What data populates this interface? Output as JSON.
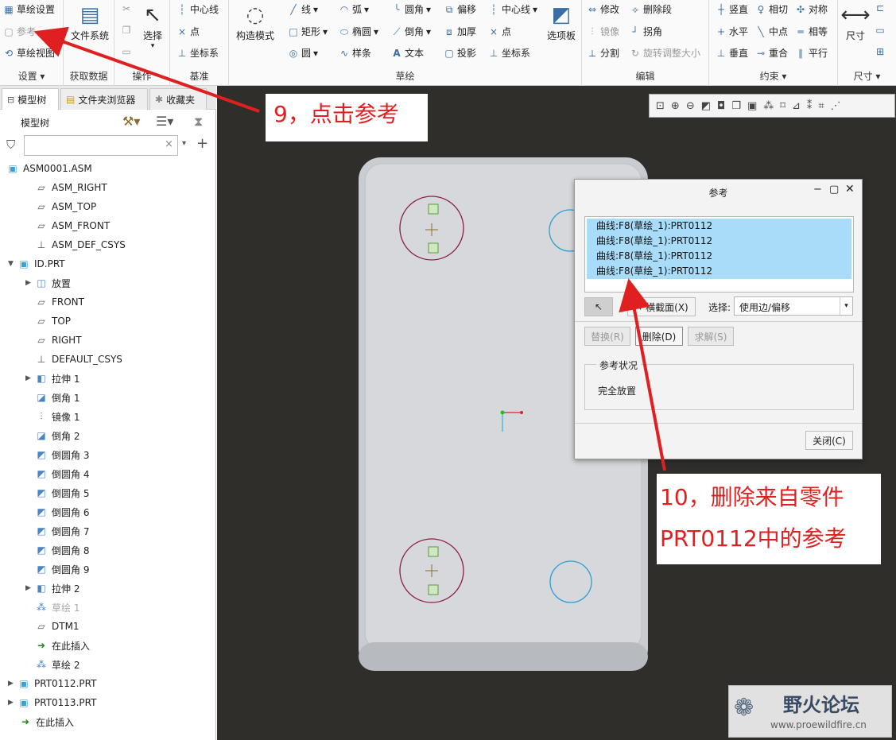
{
  "colors": {
    "accent": "#3a6ea5",
    "selection": "#a9dcf8",
    "annotation": "#e02020",
    "canvas": "#2f2e2b",
    "sketch_circle": "#8b1d4a",
    "ref_circle": "#2a9fd6"
  },
  "ribbon": {
    "settings": {
      "label": "设置",
      "items": [
        "草绘设置",
        "参考",
        "草绘视图"
      ]
    },
    "get_data": {
      "label": "获取数据",
      "file_system": "文件系统"
    },
    "ops": {
      "label": "操作",
      "select": "选择"
    },
    "datum": {
      "label": "基准",
      "items": [
        "中心线",
        "点",
        "坐标系"
      ]
    },
    "sketch": {
      "label": "草绘",
      "construction": "构造模式",
      "palette": "选项板",
      "col1": [
        "线",
        "矩形",
        "圆"
      ],
      "col2": [
        "弧",
        "椭圆",
        "样条"
      ],
      "col3": [
        "圆角",
        "倒角",
        "文本"
      ],
      "col4": [
        "偏移",
        "加厚",
        "投影"
      ],
      "col5": [
        "中心线",
        "点",
        "坐标系"
      ]
    },
    "edit": {
      "label": "编辑",
      "items": [
        "修改",
        "删除段",
        "镜像",
        "拐角",
        "分割",
        "旋转调整大小"
      ]
    },
    "constrain": {
      "label": "约束",
      "items": [
        "竖直",
        "相切",
        "对称",
        "水平",
        "中点",
        "相等",
        "垂直",
        "重合",
        "平行"
      ]
    },
    "dimension": {
      "label": "尺寸",
      "size": "尺寸"
    }
  },
  "left": {
    "tabs": [
      "模型树",
      "文件夹浏览器",
      "收藏夹"
    ],
    "tree_title": "模型树",
    "search_placeholder": "",
    "tree": [
      {
        "label": "ASM0001.ASM",
        "icon": "assembly-icon",
        "depth": 0
      },
      {
        "label": "ASM_RIGHT",
        "icon": "datum-plane-icon",
        "depth": 1
      },
      {
        "label": "ASM_TOP",
        "icon": "datum-plane-icon",
        "depth": 1
      },
      {
        "label": "ASM_FRONT",
        "icon": "datum-plane-icon",
        "depth": 1
      },
      {
        "label": "ASM_DEF_CSYS",
        "icon": "csys-icon",
        "depth": 1
      },
      {
        "label": "ID.PRT",
        "icon": "part-icon",
        "depth": 0,
        "expanded": true
      },
      {
        "label": "放置",
        "icon": "placement-icon",
        "depth": 1,
        "collapsed": true
      },
      {
        "label": "FRONT",
        "icon": "datum-plane-icon",
        "depth": 1
      },
      {
        "label": "TOP",
        "icon": "datum-plane-icon",
        "depth": 1
      },
      {
        "label": "RIGHT",
        "icon": "datum-plane-icon",
        "depth": 1
      },
      {
        "label": "DEFAULT_CSYS",
        "icon": "csys-icon",
        "depth": 1
      },
      {
        "label": "拉伸 1",
        "icon": "extrude-icon",
        "depth": 1,
        "collapsed": true
      },
      {
        "label": "倒角 1",
        "icon": "chamfer-icon",
        "depth": 1
      },
      {
        "label": "镜像 1",
        "icon": "mirror-icon",
        "depth": 1
      },
      {
        "label": "倒角 2",
        "icon": "chamfer-icon",
        "depth": 1
      },
      {
        "label": "倒圆角 3",
        "icon": "round-icon",
        "depth": 1
      },
      {
        "label": "倒圆角 4",
        "icon": "round-icon",
        "depth": 1
      },
      {
        "label": "倒圆角 5",
        "icon": "round-icon",
        "depth": 1
      },
      {
        "label": "倒圆角 6",
        "icon": "round-icon",
        "depth": 1
      },
      {
        "label": "倒圆角 7",
        "icon": "round-icon",
        "depth": 1
      },
      {
        "label": "倒圆角 8",
        "icon": "round-icon",
        "depth": 1
      },
      {
        "label": "倒圆角 9",
        "icon": "round-icon",
        "depth": 1
      },
      {
        "label": "拉伸 2",
        "icon": "extrude-icon",
        "depth": 1,
        "collapsed": true
      },
      {
        "label": "草绘 1",
        "icon": "sketch-icon",
        "depth": 1,
        "dimmed": true
      },
      {
        "label": "DTM1",
        "icon": "datum-plane-icon",
        "depth": 1
      },
      {
        "label": "在此插入",
        "icon": "insert-here-icon",
        "depth": 1
      },
      {
        "label": "草绘 2",
        "icon": "sketch-icon",
        "depth": 1
      },
      {
        "label": "PRT0112.PRT",
        "icon": "part-icon",
        "depth": 0,
        "collapsed": true
      },
      {
        "label": "PRT0113.PRT",
        "icon": "part-icon",
        "depth": 0,
        "collapsed": true
      },
      {
        "label": "在此插入",
        "icon": "insert-here-icon",
        "depth": 0
      }
    ]
  },
  "dialog": {
    "title": "参考",
    "refs": [
      "曲线:F8(草绘_1):PRT0112",
      "曲线:F8(草绘_1):PRT0112",
      "曲线:F8(草绘_1):PRT0112",
      "曲线:F8(草绘_1):PRT0112"
    ],
    "section_btn": "横截面(X)",
    "select_label": "选择:",
    "select_value": "使用边/偏移",
    "replace": "替换(R)",
    "delete": "删除(D)",
    "solve": "求解(S)",
    "status_title": "参考状况",
    "status_value": "完全放置",
    "close": "关闭(C)"
  },
  "annotations": {
    "step9": "9，点击参考",
    "step10_line1": "10，删除来自零件",
    "step10_line2": "PRT0112中的参考"
  },
  "watermark": {
    "name": "野火论坛",
    "url": "www.proewildfire.cn"
  }
}
